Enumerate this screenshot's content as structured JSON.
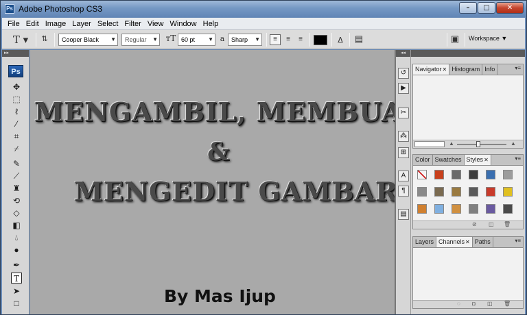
{
  "window": {
    "title": "Adobe Photoshop CS3",
    "app_icon": "Ps"
  },
  "menu": [
    "File",
    "Edit",
    "Image",
    "Layer",
    "Select",
    "Filter",
    "View",
    "Window",
    "Help"
  ],
  "options_bar": {
    "font_family": "Cooper Black",
    "font_style": "Regular",
    "font_size": "60 pt",
    "antialias_label": "a",
    "antialias": "Sharp",
    "text_color": "#000000",
    "workspace": "Workspace"
  },
  "toolbox": {
    "logo": "Ps"
  },
  "canvas": {
    "line1": "MENGAMBIL, MEMBUAT",
    "line2": "&",
    "line3": "MENGEDIT GAMBAR",
    "byline": "By Mas Ijup"
  },
  "panels": {
    "group1": {
      "tabs": [
        "Navigator",
        "Histogram",
        "Info"
      ]
    },
    "group2": {
      "tabs": [
        "Color",
        "Swatches",
        "Styles"
      ]
    },
    "group3": {
      "tabs": [
        "Layers",
        "Channels",
        "Paths"
      ]
    }
  },
  "styles_swatches": [
    "#f4f4f4",
    "#c8401c",
    "#6a6a6a",
    "#3c3c3c",
    "#3a6fb0",
    "#9c9c9c",
    "#8a8a8a",
    "#7a6a50",
    "#9a7a40",
    "#5a5a5a",
    "#c83a2a",
    "#e0c020",
    "#d08030",
    "#80b0e0",
    "#d09040",
    "#808080",
    "#6a5aa0",
    "#4a4a4a"
  ]
}
